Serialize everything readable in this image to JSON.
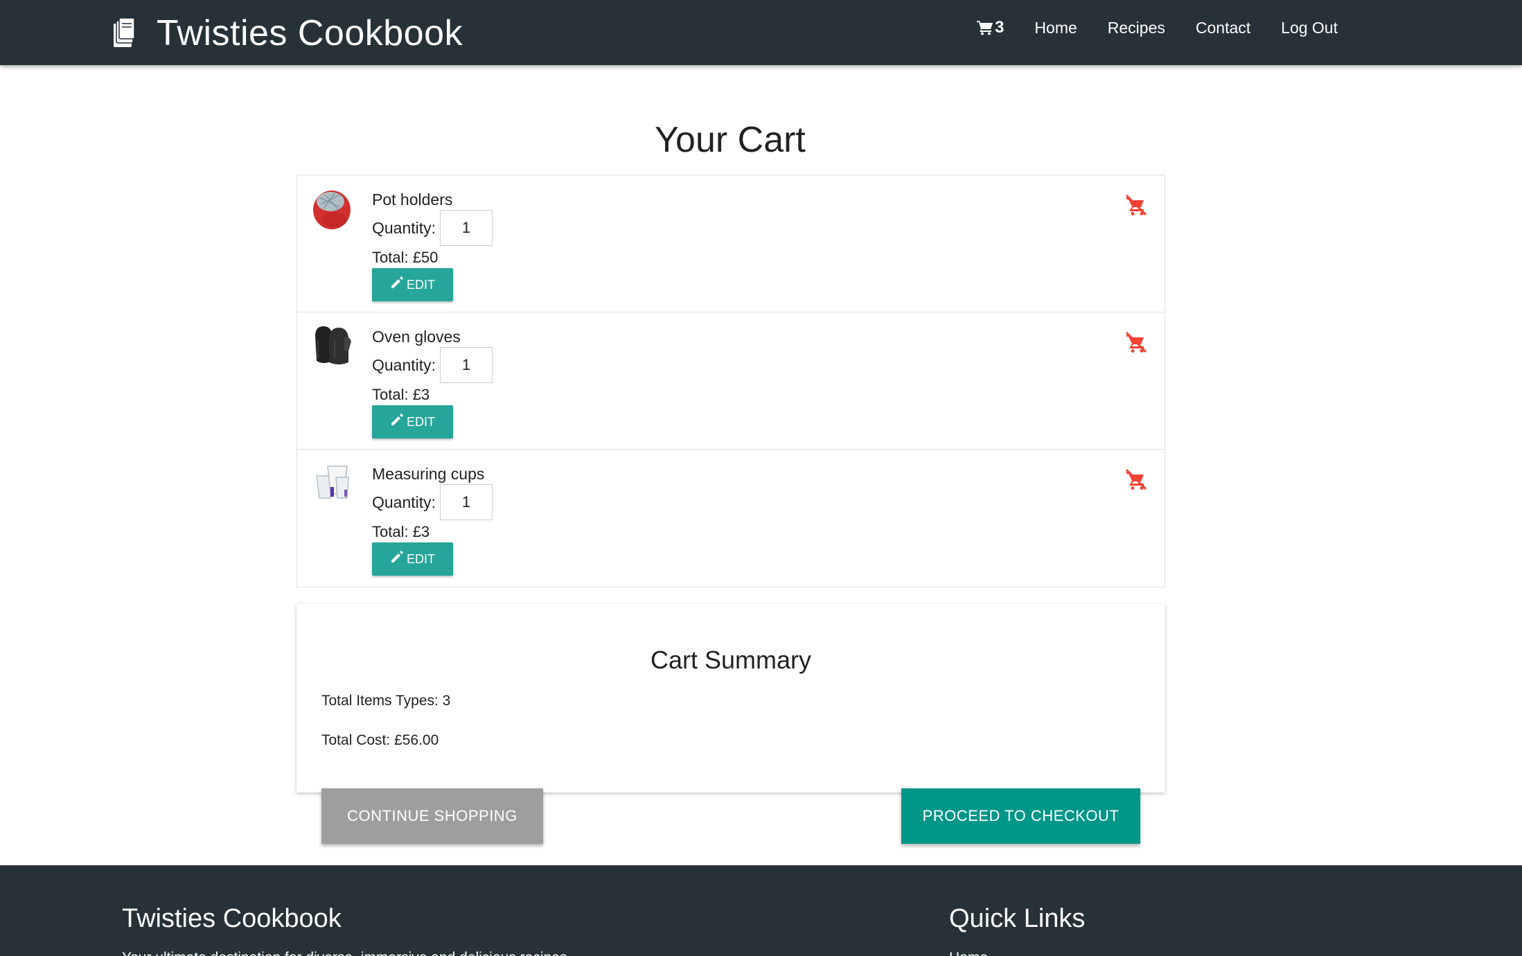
{
  "navbar": {
    "brand": "Twisties Cookbook",
    "brand_icon": "book-icon",
    "cart_count": "3",
    "links": [
      "Home",
      "Recipes",
      "Contact",
      "Log Out"
    ]
  },
  "page": {
    "title": "Your Cart"
  },
  "cart": {
    "items": [
      {
        "name": "Pot holders",
        "quantity_label": "Quantity:",
        "quantity": "1",
        "total": "Total: £50",
        "edit_label": "EDIT"
      },
      {
        "name": "Oven gloves",
        "quantity_label": "Quantity:",
        "quantity": "1",
        "total": "Total: £3",
        "edit_label": "EDIT"
      },
      {
        "name": "Measuring cups",
        "quantity_label": "Quantity:",
        "quantity": "1",
        "total": "Total: £3",
        "edit_label": "EDIT"
      }
    ]
  },
  "summary": {
    "title": "Cart Summary",
    "item_types": "Total Items Types: 3",
    "total_cost": "Total Cost: £56.00"
  },
  "actions": {
    "continue_label": "CONTINUE SHOPPING",
    "checkout_label": "PROCEED TO CHECKOUT"
  },
  "footer": {
    "left_title": "Twisties Cookbook",
    "left_text": "Your ultimate destination for diverse, immersive and delicious recipes",
    "right_title": "Quick Links",
    "right_text": "Home"
  },
  "colors": {
    "navbar": "#263238",
    "teal_button": "#26a69a",
    "checkout_button": "#009688",
    "continue_button": "#9e9e9e",
    "remove_icon": "#f44336"
  }
}
